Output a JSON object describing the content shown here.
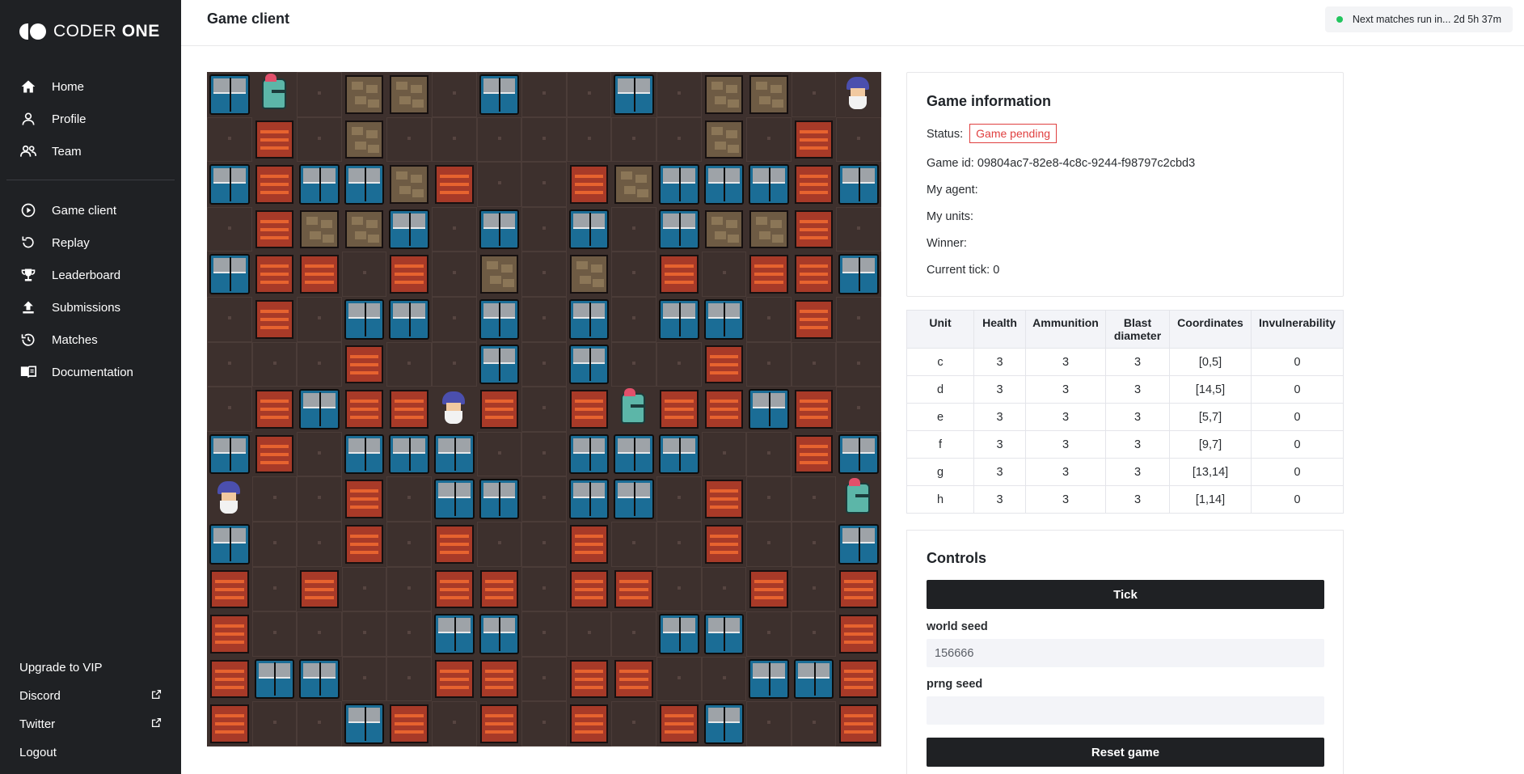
{
  "app": {
    "brand_light": "CODER",
    "brand_bold": "ONE"
  },
  "sidebar": {
    "primary": [
      {
        "label": "Home",
        "icon": "home-icon"
      },
      {
        "label": "Profile",
        "icon": "user-icon"
      },
      {
        "label": "Team",
        "icon": "users-icon"
      }
    ],
    "secondary": [
      {
        "label": "Game client",
        "icon": "play-circle-icon"
      },
      {
        "label": "Replay",
        "icon": "replay-icon"
      },
      {
        "label": "Leaderboard",
        "icon": "trophy-icon"
      },
      {
        "label": "Submissions",
        "icon": "upload-icon"
      },
      {
        "label": "Matches",
        "icon": "history-icon"
      },
      {
        "label": "Documentation",
        "icon": "book-icon"
      }
    ],
    "bottom": [
      {
        "label": "Upgrade to VIP"
      },
      {
        "label": "Discord",
        "icon": "external-link-icon"
      },
      {
        "label": "Twitter",
        "icon": "external-link-icon"
      },
      {
        "label": "Logout"
      }
    ]
  },
  "header": {
    "title": "Game client",
    "status": "Next matches run in... 2d 5h 37m"
  },
  "board": {
    "size": 15,
    "legend": {
      ".": "floor",
      "W": "wood-crate",
      "M": "metal-crate",
      "O": "ore-block",
      "K": "knight-unit",
      "Z": "wizard-unit"
    },
    "rows": [
      "MK.OO.M..M.OO.Z",
      ".W.O.......O.W.",
      "MWMMOW..WOMMMWM",
      ".WOOM.M.M.MOOW.",
      "MWW.W.O.O.W.WWM",
      ".W.MM.M.M.MM.W.",
      "...W..M.M..W...",
      ".WMWWZW.WKWWMW.",
      "MW.MMM..MMM..WM",
      "Z..W.MM.MM.W..K",
      "M..W.W..W..W..M",
      "W.W..WW.WW..W.W",
      "W....MM...MM..W",
      "WMM..WW.WW..MMW",
      "W..MW.W.W.WM..W"
    ]
  },
  "game_info": {
    "title": "Game information",
    "status_label": "Status:",
    "status_value": "Game pending",
    "status_color": "#e04040",
    "game_id_label": "Game id:",
    "game_id": "09804ac7-82e8-4c8c-9244-f98797c2cbd3",
    "my_agent_label": "My agent:",
    "my_units_label": "My units:",
    "winner_label": "Winner:",
    "current_tick_label": "Current tick:",
    "current_tick": "0"
  },
  "units_table": {
    "headers": [
      "Unit",
      "Health",
      "Ammunition",
      "Blast diameter",
      "Coordinates",
      "Invulnerability"
    ],
    "rows": [
      [
        "c",
        "3",
        "3",
        "3",
        "[0,5]",
        "0"
      ],
      [
        "d",
        "3",
        "3",
        "3",
        "[14,5]",
        "0"
      ],
      [
        "e",
        "3",
        "3",
        "3",
        "[5,7]",
        "0"
      ],
      [
        "f",
        "3",
        "3",
        "3",
        "[9,7]",
        "0"
      ],
      [
        "g",
        "3",
        "3",
        "3",
        "[13,14]",
        "0"
      ],
      [
        "h",
        "3",
        "3",
        "3",
        "[1,14]",
        "0"
      ]
    ]
  },
  "controls": {
    "title": "Controls",
    "tick_label": "Tick",
    "world_seed_label": "world seed",
    "world_seed_value": "156666",
    "prng_seed_label": "prng seed",
    "prng_seed_value": "",
    "reset_label": "Reset game"
  }
}
